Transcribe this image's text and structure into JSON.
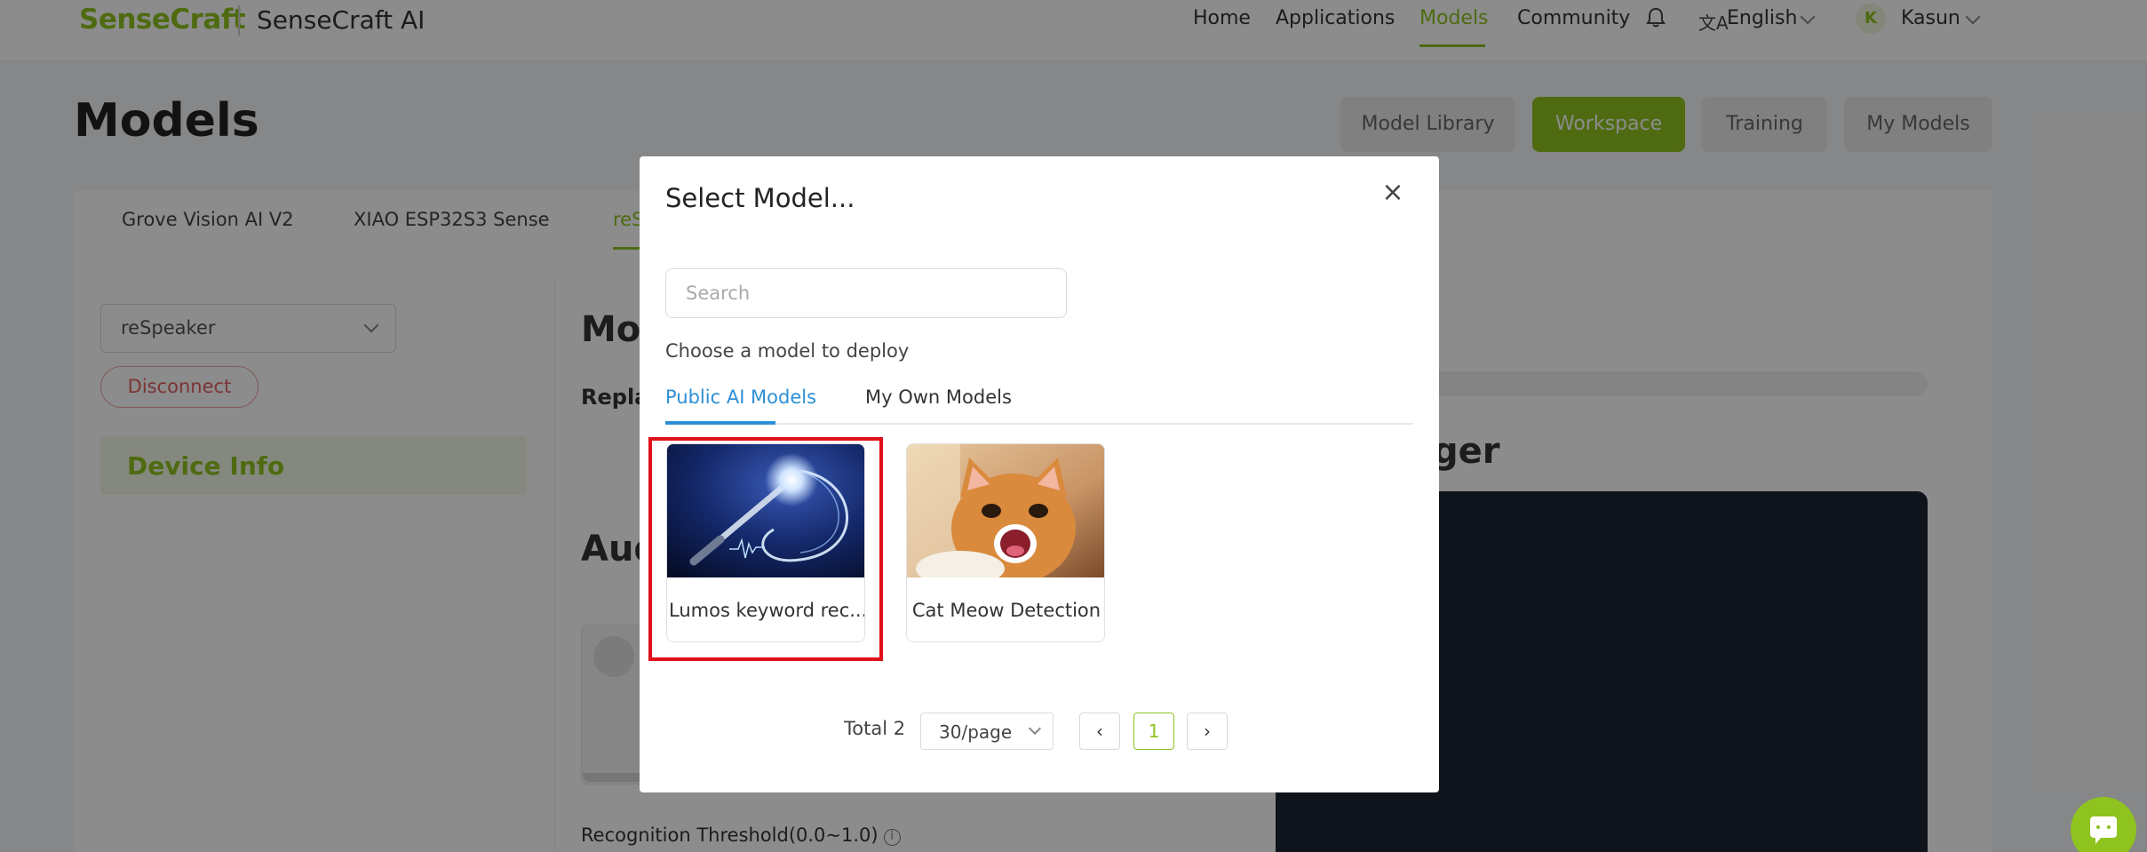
{
  "nav": {
    "logo": "SenseCraft",
    "brand": "SenseCraft AI",
    "links": [
      "Home",
      "Applications",
      "Models",
      "Community"
    ],
    "active_link": "Models",
    "language": "English",
    "user_initial": "K",
    "user_name": "Kasun"
  },
  "page": {
    "title": "Models",
    "pills": [
      "Model Library",
      "Workspace",
      "Training",
      "My Models"
    ],
    "active_pill": "Workspace"
  },
  "device": {
    "tabs": [
      "Grove Vision AI V2",
      "XIAO ESP32S3 Sense",
      "reS"
    ],
    "active_tab": "reS",
    "selected_device": "reSpeaker",
    "disconnect_label": "Disconnect",
    "device_info_label": "Device Info"
  },
  "workspace": {
    "model_heading_partial": "Moc",
    "replace_partial": "Repla",
    "audio_heading_partial": "Aud",
    "logger_heading_partial": "ger",
    "threshold_label": "Recognition Threshold(0.0~1.0)"
  },
  "modal": {
    "title": "Select Model...",
    "search_placeholder": "Search",
    "subtitle": "Choose a model to deploy",
    "tabs": [
      "Public AI Models",
      "My Own Models"
    ],
    "active_tab": "Public AI Models",
    "models": [
      {
        "name": "Lumos keyword rec...",
        "image": "magic-wand-sound-wave"
      },
      {
        "name": "Cat Meow Detection",
        "image": "meowing-cat-photo"
      }
    ],
    "highlighted_model": "Lumos keyword rec...",
    "pagination": {
      "total_label": "Total 2",
      "per_page": "30/page",
      "current_page": "1"
    }
  },
  "colors": {
    "brand_green": "#8fc31f",
    "tab_blue": "#2d8fd5",
    "highlight_red": "#e0101a",
    "terminal_bg": "#1c2332"
  }
}
